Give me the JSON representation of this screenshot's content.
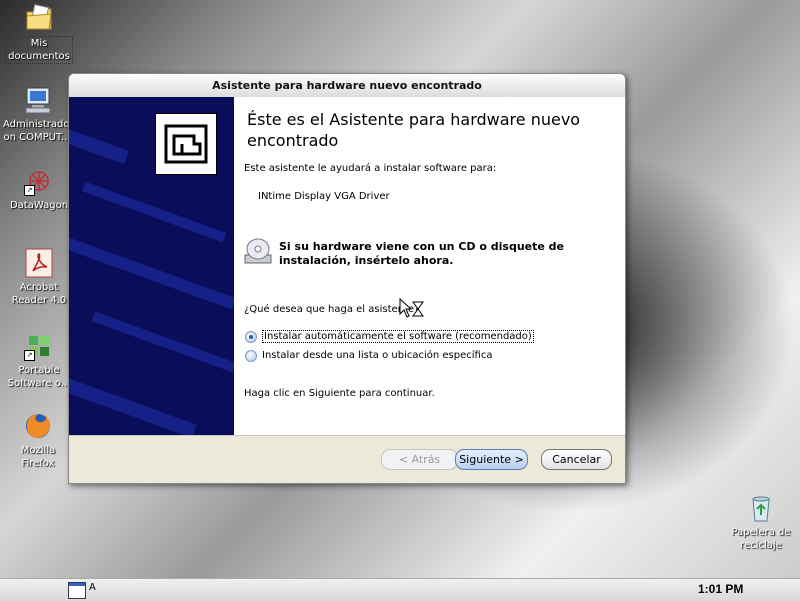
{
  "desktop": {
    "icons": [
      {
        "label": "Mis documentos",
        "icon": "folder-documents-icon"
      },
      {
        "label": "Administrador on COMPUT...",
        "icon": "computer-icon"
      },
      {
        "label": "DataWagon",
        "icon": "datawagon-icon"
      },
      {
        "label": "Acrobat Reader 4.0",
        "icon": "acrobat-icon"
      },
      {
        "label": "Portable Software o...",
        "icon": "portable-software-icon"
      },
      {
        "label": "Mozilla Firefox",
        "icon": "firefox-icon"
      },
      {
        "label": "Papelera de reciclaje",
        "icon": "recycle-bin-icon"
      }
    ]
  },
  "dialog": {
    "title": "Asistente para hardware nuevo encontrado",
    "heading": "Éste es el Asistente para hardware nuevo encontrado",
    "intro": "Este asistente le ayudará a instalar software para:",
    "device": "INtime Display VGA Driver",
    "cd_prompt": "Si su hardware viene con un CD o disquete de instalación, insértelo ahora.",
    "question": "¿Qué desea que haga el asistente?",
    "options": [
      {
        "label": "Instalar automáticamente el software (recomendado)",
        "selected": true
      },
      {
        "label": "Instalar desde una lista o ubicación específica",
        "selected": false
      }
    ],
    "continue_text": "Haga clic en Siguiente para continuar.",
    "buttons": {
      "back": "< Atrás",
      "next": "Siguiente >",
      "cancel": "Cancelar"
    }
  },
  "taskbar": {
    "task_label": "A",
    "clock": "1:01 PM"
  },
  "colors": {
    "wizard_panel": "#0a0e5a",
    "button_accent": "#5a7fb8"
  }
}
